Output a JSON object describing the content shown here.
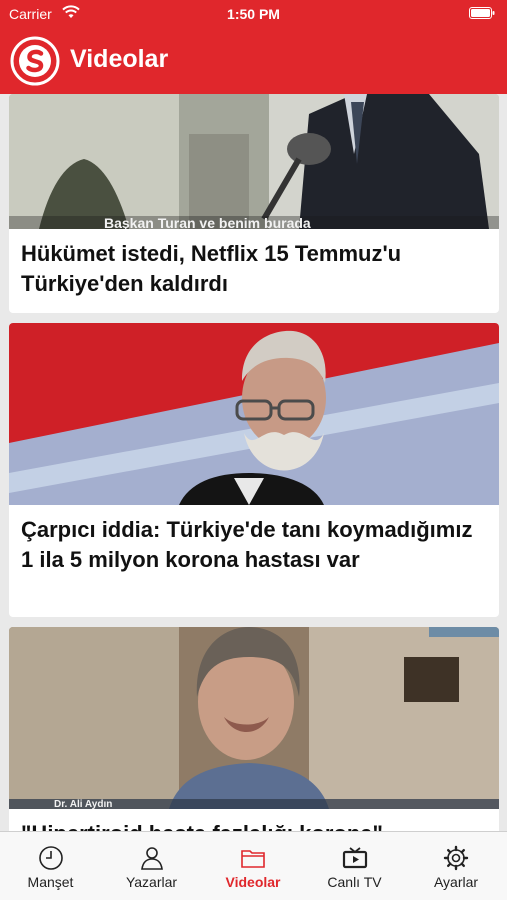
{
  "status": {
    "carrier": "Carrier",
    "time": "1:50 PM"
  },
  "header": {
    "title": "Videolar",
    "logo_icon": "s-logo-icon"
  },
  "articles": [
    {
      "caption": "Başkan Turan ve benim burada",
      "headline": "Hükümet istedi, Netflix 15 Temmuz'u Türkiye'den kaldırdı"
    },
    {
      "headline": "Çarpıcı iddia: Türkiye'de tanı koymadığımız 1 ila 5 milyon korona hastası var"
    },
    {
      "caption": "Dr. Ali Aydın",
      "headline": "\"Hipertiroid hasta fazlalığı korona\""
    }
  ],
  "tabs": [
    {
      "label": "Manşet",
      "icon": "clock-icon"
    },
    {
      "label": "Yazarlar",
      "icon": "person-icon"
    },
    {
      "label": "Videolar",
      "icon": "folder-icon",
      "active": true
    },
    {
      "label": "Canlı TV",
      "icon": "tv-icon"
    },
    {
      "label": "Ayarlar",
      "icon": "gear-icon"
    }
  ],
  "colors": {
    "brand": "#e0272c",
    "background": "#e9e9e9",
    "card": "#ffffff"
  }
}
